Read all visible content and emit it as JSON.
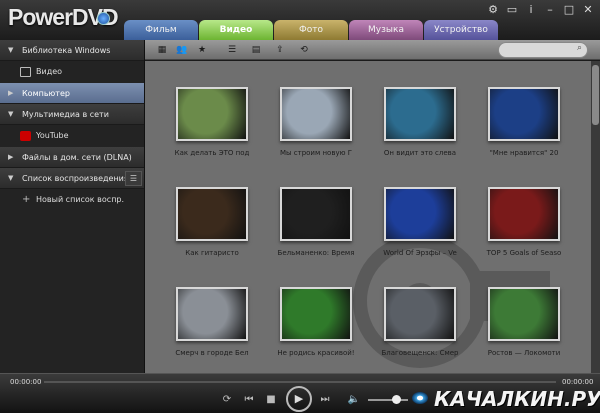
{
  "app": {
    "logo": "PowerDVD"
  },
  "tabs": [
    {
      "label": "Фильм"
    },
    {
      "label": "Видео"
    },
    {
      "label": "Фото"
    },
    {
      "label": "Музыка"
    },
    {
      "label": "Устройство"
    }
  ],
  "sidebar": {
    "sections": [
      {
        "label": "Библиотека Windows",
        "expanded": true
      },
      {
        "label": "Видео",
        "icon": "film-icon"
      },
      {
        "label": "Компьютер",
        "selected": true
      },
      {
        "label": "Мультимедиа в сети",
        "expanded": true
      },
      {
        "label": "YouTube",
        "icon": "youtube-icon"
      },
      {
        "label": "Файлы в дом. сети (DLNA)"
      },
      {
        "label": "Список воспроизведения",
        "expanded": true
      },
      {
        "label": "Новый список воспр."
      }
    ]
  },
  "toolbar": {
    "buttons": [
      "grid-view-icon",
      "users-icon",
      "star-icon",
      "list-icon",
      "details-icon",
      "upload-icon",
      "rotate-icon"
    ],
    "search_placeholder": ""
  },
  "videos": [
    {
      "title": "Как делать ЭТО под",
      "thumb": "#6b8b4a"
    },
    {
      "title": "Мы строим новую Г",
      "thumb": "#9aa7b5"
    },
    {
      "title": "Он видит это слева",
      "thumb": "#2c6c8f"
    },
    {
      "title": "\"Мне нравится\" 20",
      "thumb": "#1c3f86"
    },
    {
      "title": "Как гитаристо",
      "thumb": "#3b2a1c"
    },
    {
      "title": "Бельманенко: Время",
      "thumb": "#1f1f1f"
    },
    {
      "title": "World Of Эрзфы – Ve",
      "thumb": "#1d3e9a"
    },
    {
      "title": "TOP 5 Goals of Seaso",
      "thumb": "#7a1a1a"
    },
    {
      "title": "Смерч в городе Бел",
      "thumb": "#8a8f96"
    },
    {
      "title": "Не родись красивой!",
      "thumb": "#2f7a2a"
    },
    {
      "title": "Благовещенск: Смер",
      "thumb": "#5a5f66"
    },
    {
      "title": "Ростов — Локомоти",
      "thumb": "#3d7a36"
    }
  ],
  "player": {
    "time_current": "00:00:00",
    "time_total": "00:00:00",
    "volume": 0.7
  },
  "watermark": "КАЧАЛКИН.РУ"
}
